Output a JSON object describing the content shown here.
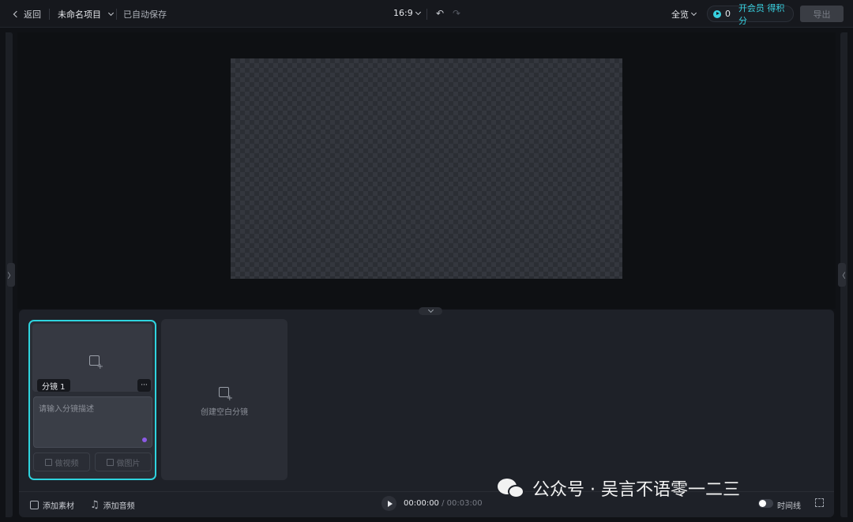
{
  "header": {
    "back_label": "返回",
    "project_name": "未命名项目",
    "save_status": "已自动保存",
    "aspect_ratio": "16:9",
    "preview_label": "全览",
    "credit_count": "0",
    "member_label": "开会员 得积分",
    "export_label": "导出"
  },
  "storyboard": {
    "shot_tag": "分镜 1",
    "more_label": "···",
    "desc_placeholder": "请输入分镜描述",
    "gen_video_label": "做视频",
    "gen_image_label": "做图片",
    "create_blank_label": "创建空白分镜"
  },
  "footer": {
    "add_material_label": "添加素材",
    "add_audio_label": "添加音频",
    "current_time": "00:00:00",
    "separator": "/",
    "total_time": "00:03:00",
    "timeline_label": "时间线"
  },
  "watermark": {
    "text": "公众号 · 吴言不语零一二三"
  },
  "colors": {
    "accent": "#2ed3de",
    "background": "#101216",
    "panel": "#1e2128"
  }
}
